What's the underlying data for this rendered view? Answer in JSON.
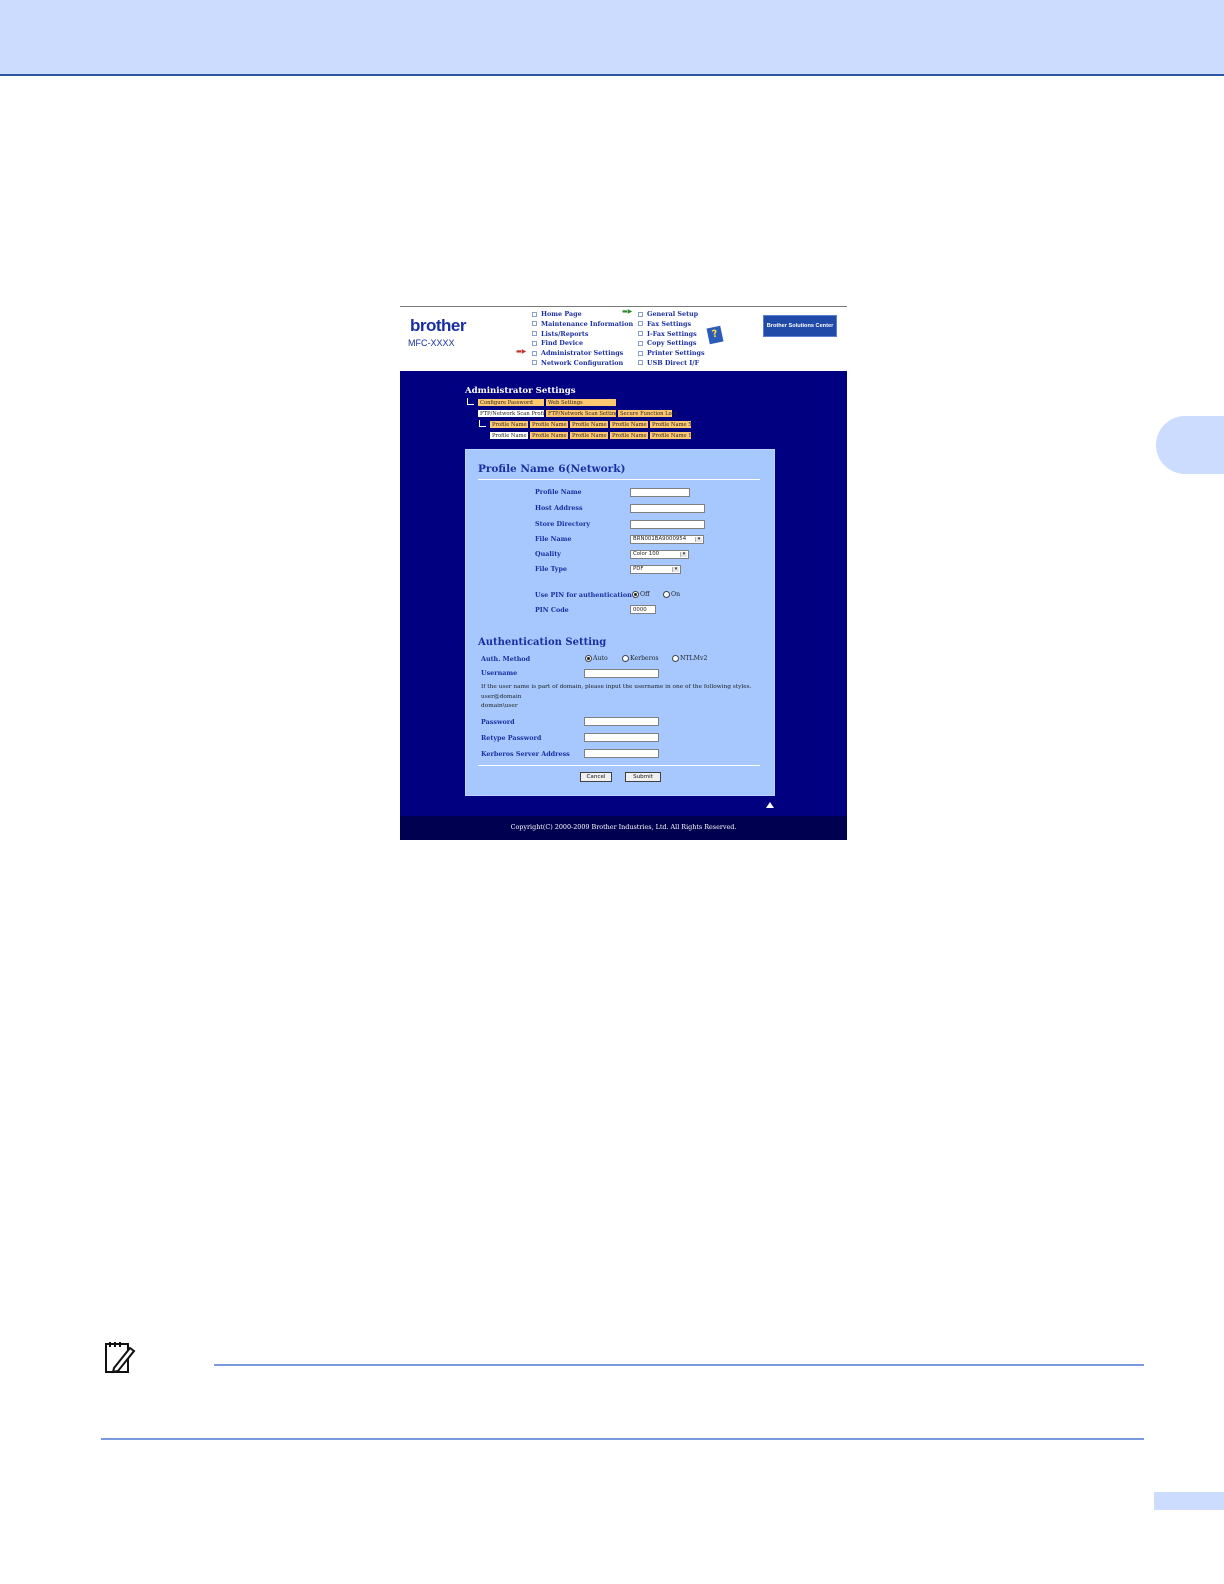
{
  "page": {
    "accent": "#ccdcff",
    "rule_color": "#2f56a8"
  },
  "header": {
    "logo": "brother",
    "model": "MFC-XXXX",
    "solutions_button": "Brother Solutions Center"
  },
  "nav": {
    "left": [
      "Home Page",
      "Maintenance Information",
      "Lists/Reports",
      "Find Device",
      "Administrator Settings",
      "Network Configuration"
    ],
    "right": [
      "General Setup",
      "Fax Settings",
      "I-Fax Settings",
      "Copy Settings",
      "Printer Settings",
      "USB Direct I/F"
    ]
  },
  "admin": {
    "title": "Administrator Settings",
    "tabs_row1": [
      "Configure Password",
      "Web Settings"
    ],
    "tabs_row2": [
      "FTP/Network Scan Profile",
      "FTP/Network Scan Settings",
      "Secure Function Lock"
    ],
    "profiles_row1": [
      "Profile Name 1",
      "Profile Name 2",
      "Profile Name 3",
      "Profile Name 4",
      "Profile Name 5"
    ],
    "profiles_row2": [
      "Profile Name 6",
      "Profile Name 7",
      "Profile Name 8",
      "Profile Name 9",
      "Profile Name 10"
    ]
  },
  "form": {
    "title": "Profile Name 6(Network)",
    "profile_name_label": "Profile Name",
    "host_address_label": "Host Address",
    "store_directory_label": "Store Directory",
    "file_name_label": "File Name",
    "file_name_value": "BRN001BA9000954",
    "quality_label": "Quality",
    "quality_value": "Color 100",
    "file_type_label": "File Type",
    "file_type_value": "PDF",
    "pin_auth_label": "Use PIN for authentication",
    "pin_off": "Off",
    "pin_on": "On",
    "pin_code_label": "PIN Code",
    "pin_code_value": "0000"
  },
  "auth": {
    "title": "Authentication Setting",
    "method_label": "Auth. Method",
    "auto": "Auto",
    "kerberos": "Kerberos",
    "ntlm": "NTLMv2",
    "username_label": "Username",
    "hint_line1": "If the user name is part of domain, please input the username in one of the following styles.",
    "hint_line2": "user@domain",
    "hint_line3": "domain\\user",
    "password_label": "Password",
    "retype_label": "Retype Password",
    "kerberos_server_label": "Kerberos Server Address"
  },
  "buttons": {
    "cancel": "Cancel",
    "submit": "Submit"
  },
  "footer": {
    "copyright": "Copyright(C) 2000-2009 Brother Industries, Ltd. All Rights Reserved."
  }
}
